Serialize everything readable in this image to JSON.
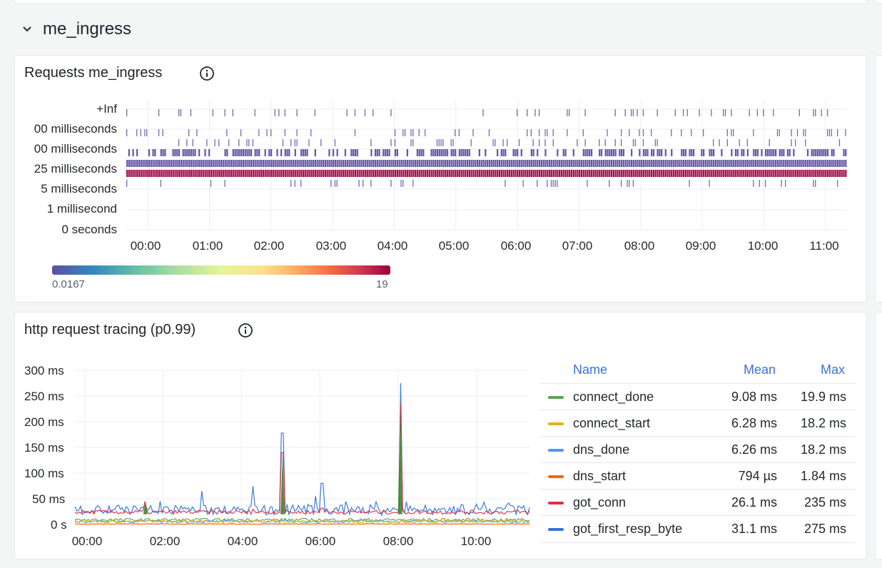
{
  "row": {
    "title": "me_ingress"
  },
  "heatmap_panel": {
    "title": "Requests me_ingress",
    "color_scale": {
      "min": "0.0167",
      "max": "19",
      "palette": "spectral"
    }
  },
  "trace_panel": {
    "title": "http request tracing (p0.99)",
    "legend": {
      "headers": {
        "name": "Name",
        "mean": "Mean",
        "max": "Max"
      },
      "rows": [
        {
          "name": "connect_done",
          "mean": "9.08 ms",
          "max": "19.9 ms",
          "color": "#56a64b"
        },
        {
          "name": "connect_start",
          "mean": "6.28 ms",
          "max": "18.2 ms",
          "color": "#e0b400"
        },
        {
          "name": "dns_done",
          "mean": "6.26 ms",
          "max": "18.2 ms",
          "color": "#5794f2"
        },
        {
          "name": "dns_start",
          "mean": "794 µs",
          "max": "1.84 ms",
          "color": "#fa6400"
        },
        {
          "name": "got_conn",
          "mean": "26.1 ms",
          "max": "235 ms",
          "color": "#e02f44"
        },
        {
          "name": "got_first_resp_byte",
          "mean": "31.1 ms",
          "max": "275 ms",
          "color": "#3274d9"
        }
      ]
    }
  },
  "chart_data": [
    {
      "type": "heatmap",
      "title": "Requests me_ingress",
      "y_buckets": [
        "0 seconds",
        "1 millisecond",
        "5 milliseconds",
        "25 milliseconds",
        "00 milliseconds",
        "00 milliseconds",
        "+Inf"
      ],
      "x_ticks": [
        "00:00",
        "01:00",
        "02:00",
        "03:00",
        "04:00",
        "05:00",
        "06:00",
        "07:00",
        "08:00",
        "09:00",
        "10:00",
        "11:00"
      ],
      "x_range_hours": [
        -0.35,
        11.35
      ],
      "bucket_density": [
        0,
        0,
        0.12,
        1,
        0.55,
        0.14,
        0.18,
        0.16
      ],
      "bucket_level": [
        0,
        0,
        0.03,
        0.97,
        0.04,
        0.02,
        0.02,
        0.02
      ],
      "color_min": 0.0167,
      "color_max": 19
    },
    {
      "type": "line",
      "title": "http request tracing (p0.99)",
      "y_ticks": [
        "0 s",
        "50 ms",
        "100 ms",
        "150 ms",
        "200 ms",
        "250 ms",
        "300 ms"
      ],
      "ylim": [
        0,
        300
      ],
      "y_unit": "ms",
      "x_ticks": [
        "00:00",
        "02:00",
        "04:00",
        "06:00",
        "08:00",
        "10:00"
      ],
      "x_range_hours": [
        -0.25,
        11.35
      ],
      "baseline_ms": {
        "got_first_resp_byte": 28,
        "got_conn": 24,
        "connect_done": 9,
        "connect_start": 6,
        "dns_done": 6,
        "dns_start": 1
      },
      "spikes": [
        {
          "x_hours": 1.55,
          "series": "got_conn",
          "value": 45
        },
        {
          "x_hours": 3.0,
          "series": "got_first_resp_byte",
          "value": 65
        },
        {
          "x_hours": 4.3,
          "series": "got_first_resp_byte",
          "value": 75
        },
        {
          "x_hours": 5.05,
          "series": "got_first_resp_byte",
          "value": 178
        },
        {
          "x_hours": 5.05,
          "series": "got_conn",
          "value": 140
        },
        {
          "x_hours": 5.9,
          "series": "got_first_resp_byte",
          "value": 55
        },
        {
          "x_hours": 6.05,
          "series": "got_first_resp_byte",
          "value": 80
        },
        {
          "x_hours": 8.05,
          "series": "got_first_resp_byte",
          "value": 275
        },
        {
          "x_hours": 8.05,
          "series": "got_conn",
          "value": 235
        }
      ]
    }
  ]
}
